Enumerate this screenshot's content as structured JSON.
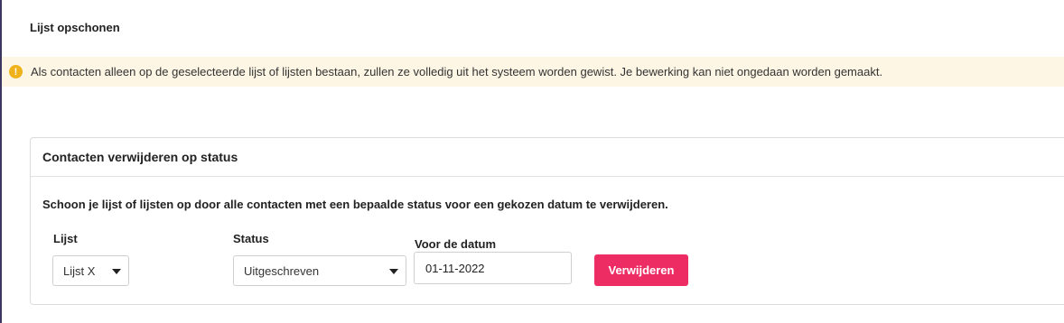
{
  "page": {
    "title": "Lijst opschonen"
  },
  "alert": {
    "icon": "warning-icon",
    "icon_glyph": "!",
    "text": "Als contacten alleen op de geselecteerde lijst of lijsten bestaan, zullen ze volledig uit het systeem worden gewist. Je bewerking kan niet ongedaan worden gemaakt.",
    "color": "#f0b21b",
    "background": "#fdf6e4"
  },
  "card": {
    "title": "Contacten verwijderen op status",
    "description": "Schoon je lijst of lijsten op door alle contacten met een bepaalde status voor een gekozen datum te verwijderen."
  },
  "form": {
    "list": {
      "label": "Lijst",
      "value": "Lijst X"
    },
    "status": {
      "label": "Status",
      "value": "Uitgeschreven"
    },
    "date": {
      "label": "Voor de datum",
      "value": "01-11-2022"
    },
    "submit_label": "Verwijderen",
    "submit_color": "#ee2c64"
  }
}
